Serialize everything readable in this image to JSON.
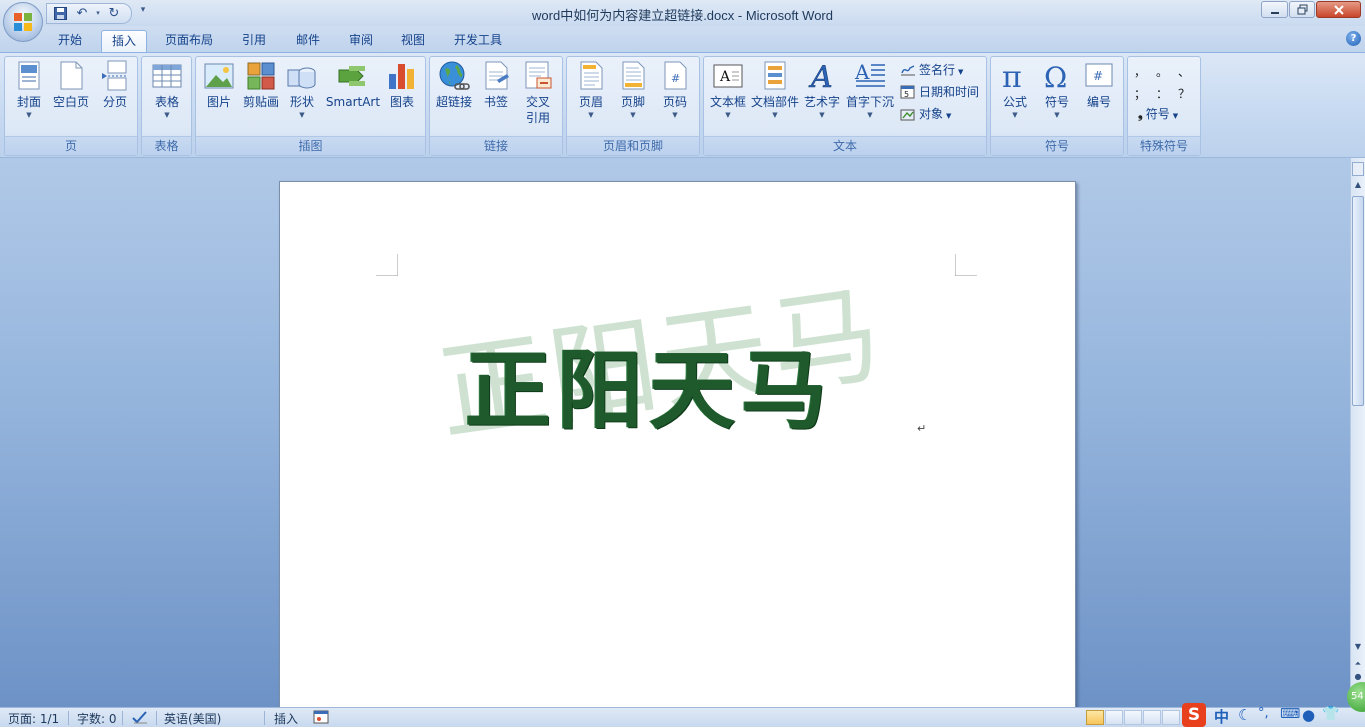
{
  "window": {
    "title": "word中如何为内容建立超链接.docx - Microsoft Word",
    "buttons": [
      "minimize",
      "restore",
      "close"
    ]
  },
  "tabs": [
    {
      "label": "开始",
      "active": false
    },
    {
      "label": "插入",
      "active": true
    },
    {
      "label": "页面布局",
      "active": false
    },
    {
      "label": "引用",
      "active": false
    },
    {
      "label": "邮件",
      "active": false
    },
    {
      "label": "审阅",
      "active": false
    },
    {
      "label": "视图",
      "active": false
    },
    {
      "label": "开发工具",
      "active": false
    }
  ],
  "ribbon": {
    "pages": {
      "label": "页",
      "cover": "封面",
      "blank": "空白页",
      "break": "分页"
    },
    "tables": {
      "label": "表格",
      "table": "表格"
    },
    "illustrations": {
      "label": "插图",
      "picture": "图片",
      "clipart": "剪贴画",
      "shapes": "形状",
      "smartart": "SmartArt",
      "chart": "图表"
    },
    "links": {
      "label": "链接",
      "hyperlink": "超链接",
      "bookmark": "书签",
      "crossref_1": "交叉",
      "crossref_2": "引用"
    },
    "headerfooter": {
      "label": "页眉和页脚",
      "header": "页眉",
      "footer": "页脚",
      "pagenum": "页码"
    },
    "text": {
      "label": "文本",
      "textbox": "文本框",
      "quickparts": "文档部件",
      "wordart": "艺术字",
      "dropcap": "首字下沉",
      "signature": "签名行",
      "datetime": "日期和时间",
      "object": "对象"
    },
    "symbols": {
      "label": "符号",
      "equation": "公式",
      "symbol": "符号",
      "numbering": "编号"
    },
    "special": {
      "label": "特殊符号",
      "chars": [
        "，",
        "。",
        "、",
        "；",
        "：",
        "？"
      ],
      "symbol": "符号"
    }
  },
  "document": {
    "wordart": "正阳天马",
    "watermark": "正阳天马",
    "paragraph_mark": "↵"
  },
  "statusbar": {
    "page": "页面: 1/1",
    "words": "字数: 0",
    "language": "英语(美国)",
    "mode": "插入"
  },
  "ime": {
    "logo": "S",
    "lang": "中"
  },
  "badge": "54"
}
